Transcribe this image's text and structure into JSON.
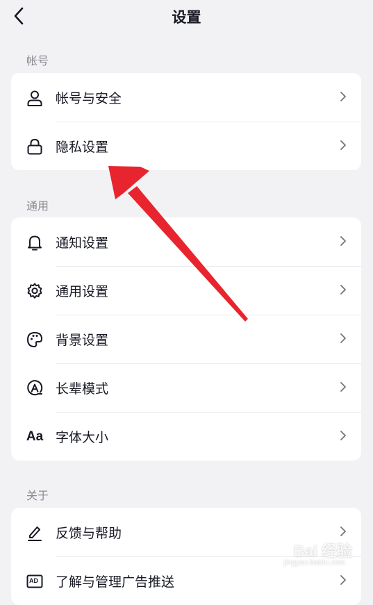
{
  "header": {
    "title": "设置",
    "back_icon": "chevron-left-icon"
  },
  "sections": [
    {
      "label": "帐号",
      "items": [
        {
          "label": "帐号与安全",
          "icon": "user-icon"
        },
        {
          "label": "隐私设置",
          "icon": "lock-icon"
        }
      ]
    },
    {
      "label": "通用",
      "items": [
        {
          "label": "通知设置",
          "icon": "bell-icon"
        },
        {
          "label": "通用设置",
          "icon": "gear-icon"
        },
        {
          "label": "背景设置",
          "icon": "palette-icon"
        },
        {
          "label": "长辈模式",
          "icon": "elder-mode-icon"
        },
        {
          "label": "字体大小",
          "icon": "font-size-icon",
          "icon_text": "Aa"
        }
      ]
    },
    {
      "label": "关于",
      "items": [
        {
          "label": "反馈与帮助",
          "icon": "edit-icon"
        },
        {
          "label": "了解与管理广告推送",
          "icon": "ad-icon",
          "icon_text": "AD"
        }
      ]
    }
  ],
  "annotation": {
    "arrow_color": "#e8252e"
  },
  "watermark": {
    "text": "Bai 经验",
    "sub": "jingyan.baidu.com"
  }
}
